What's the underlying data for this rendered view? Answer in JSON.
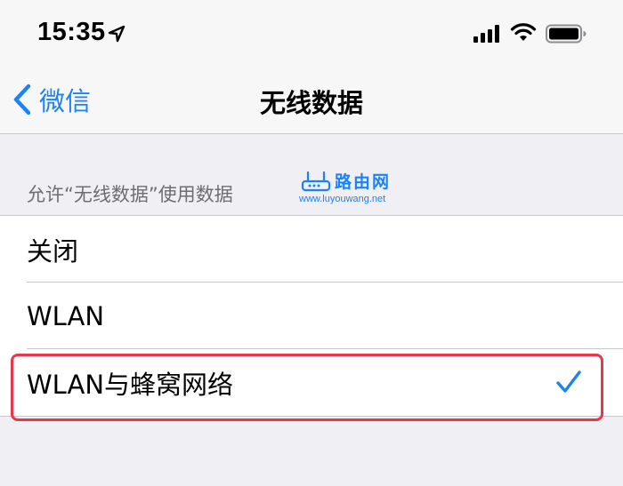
{
  "status_bar": {
    "time": "15:35"
  },
  "nav": {
    "back_label": "微信",
    "title": "无线数据"
  },
  "section": {
    "header": "允许“无线数据”使用数据"
  },
  "watermark": {
    "name": "路由网",
    "url": "www.luyouwang.net"
  },
  "options": [
    {
      "label": "关闭",
      "selected": false
    },
    {
      "label": "WLAN",
      "selected": false
    },
    {
      "label": "WLAN与蜂窝网络",
      "selected": true
    }
  ],
  "colors": {
    "accent": "#1a82fb",
    "highlight": "#e8364a",
    "background": "#efeff4"
  }
}
